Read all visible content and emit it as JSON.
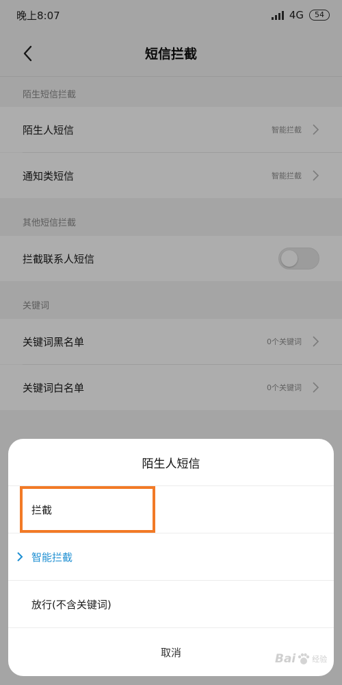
{
  "status_bar": {
    "time": "晚上8:07",
    "network": "4G",
    "battery": "54"
  },
  "header": {
    "title": "短信拦截"
  },
  "sections": [
    {
      "label": "陌生短信拦截",
      "rows": [
        {
          "label": "陌生人短信",
          "value": "智能拦截"
        },
        {
          "label": "通知类短信",
          "value": "智能拦截"
        }
      ]
    },
    {
      "label": "其他短信拦截",
      "rows": [
        {
          "label": "拦截联系人短信",
          "toggle": false
        }
      ]
    },
    {
      "label": "关键词",
      "rows": [
        {
          "label": "关键词黑名单",
          "value": "0个关键词"
        },
        {
          "label": "关键词白名单",
          "value": "0个关键词"
        }
      ]
    }
  ],
  "sheet": {
    "title": "陌生人短信",
    "options": [
      {
        "label": "拦截",
        "selected": false
      },
      {
        "label": "智能拦截",
        "selected": true
      },
      {
        "label": "放行(不含关键词)",
        "selected": false
      }
    ],
    "cancel": "取消"
  },
  "colors": {
    "accent": "#1e8fd2",
    "highlight": "#f27a26"
  },
  "watermark": {
    "text": "Bai",
    "sub": "经验"
  }
}
